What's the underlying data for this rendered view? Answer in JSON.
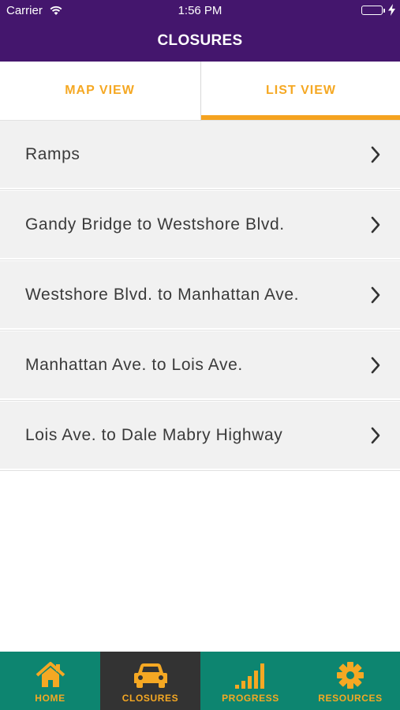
{
  "status_bar": {
    "carrier": "Carrier",
    "time": "1:56 PM"
  },
  "header": {
    "title": "CLOSURES"
  },
  "tabs": [
    {
      "label": "MAP VIEW",
      "selected": false
    },
    {
      "label": "LIST VIEW",
      "selected": true
    }
  ],
  "closures": [
    {
      "label": "Ramps"
    },
    {
      "label": "Gandy Bridge to Westshore Blvd."
    },
    {
      "label": "Westshore Blvd. to Manhattan Ave."
    },
    {
      "label": "Manhattan Ave. to Lois Ave."
    },
    {
      "label": "Lois Ave. to Dale Mabry Highway"
    }
  ],
  "tabbar": [
    {
      "label": "HOME",
      "icon": "home-icon",
      "active": false
    },
    {
      "label": "CLOSURES",
      "icon": "car-icon",
      "active": true
    },
    {
      "label": "PROGRESS",
      "icon": "signal-bars-icon",
      "active": false
    },
    {
      "label": "RESOURCES",
      "icon": "gear-icon",
      "active": false
    }
  ],
  "colors": {
    "header": "#44166d",
    "accent": "#f5a823",
    "tabbar": "#0d8570",
    "tabbar_active": "#333333",
    "row_bg": "#f1f1f1"
  }
}
